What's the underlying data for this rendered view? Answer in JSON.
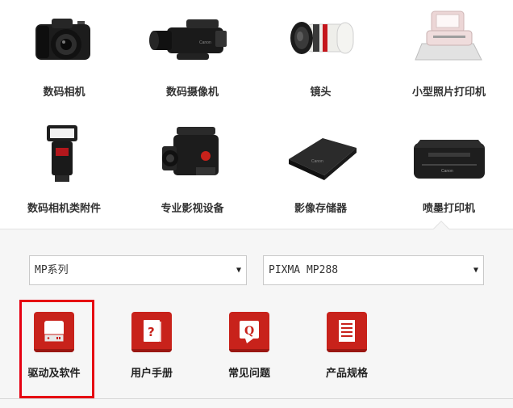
{
  "categories": [
    {
      "label": "数码相机",
      "icon": "dslr-camera-icon"
    },
    {
      "label": "数码摄像机",
      "icon": "video-camcorder-icon"
    },
    {
      "label": "镜头",
      "icon": "telephoto-lens-icon"
    },
    {
      "label": "小型照片打印机",
      "icon": "photo-printer-icon"
    },
    {
      "label": "数码相机类附件",
      "icon": "speedlite-flash-icon"
    },
    {
      "label": "专业影视设备",
      "icon": "cinema-camera-icon"
    },
    {
      "label": "影像存储器",
      "icon": "storage-device-icon"
    },
    {
      "label": "喷墨打印机",
      "icon": "inkjet-printer-icon"
    }
  ],
  "filters": {
    "series": {
      "value": "MP系列"
    },
    "model": {
      "value": "PIXMA MP288"
    }
  },
  "actions": [
    {
      "label": "驱动及软件",
      "icon": "driver-drive-icon"
    },
    {
      "label": "用户手册",
      "icon": "user-manual-icon"
    },
    {
      "label": "常见问题",
      "icon": "faq-icon"
    },
    {
      "label": "产品规格",
      "icon": "specifications-icon"
    }
  ],
  "colors": {
    "accent": "#c8221b",
    "highlight": "#e60012",
    "panel": "#f6f6f6"
  }
}
